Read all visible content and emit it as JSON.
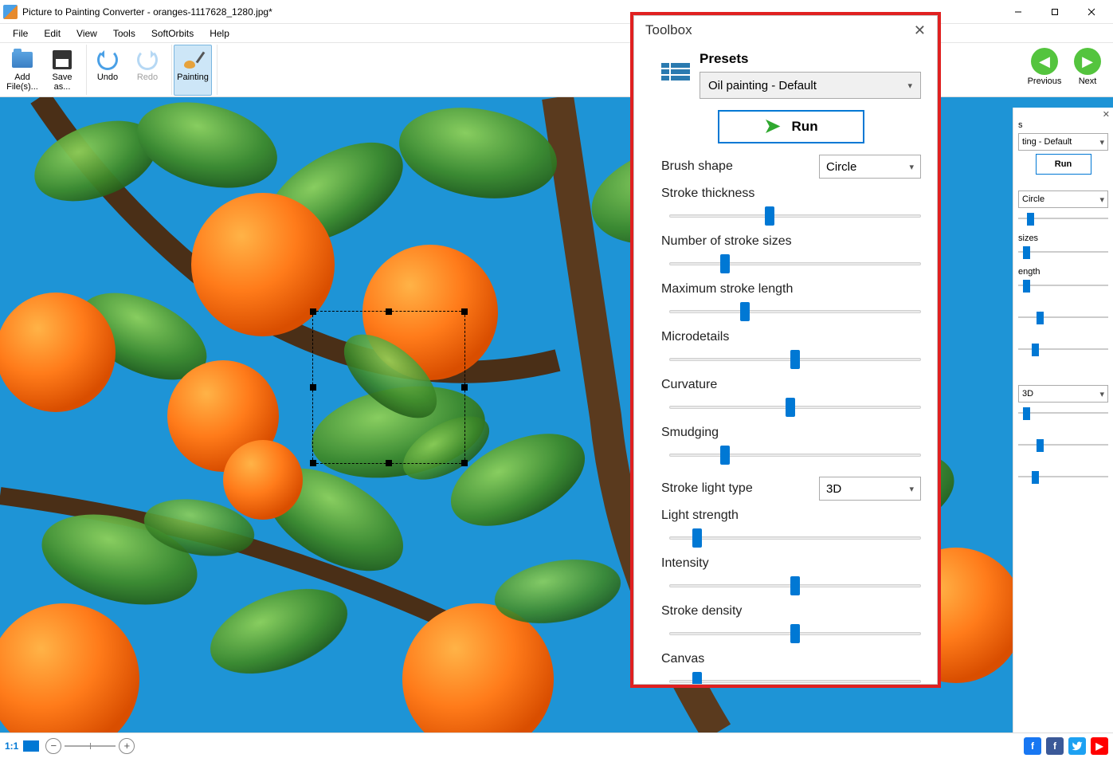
{
  "window": {
    "title": "Picture to Painting Converter - oranges-1117628_1280.jpg*"
  },
  "menu": {
    "file": "File",
    "edit": "Edit",
    "view": "View",
    "tools": "Tools",
    "softorbits": "SoftOrbits",
    "help": "Help"
  },
  "toolbar": {
    "add_files": "Add File(s)...",
    "save_as": "Save as...",
    "undo": "Undo",
    "redo": "Redo",
    "painting": "Painting",
    "previous": "Previous",
    "next": "Next"
  },
  "status": {
    "zoom": "1:1"
  },
  "sidepanel": {
    "preset": "ting - Default",
    "run": "Run",
    "brush_value": "Circle",
    "sizes_label": "sizes",
    "length_label": "ength",
    "light_value": "3D"
  },
  "toolbox": {
    "title": "Toolbox",
    "presets_label": "Presets",
    "preset_value": "Oil painting - Default",
    "run": "Run",
    "brush_shape_label": "Brush shape",
    "brush_shape_value": "Circle",
    "stroke_thickness_label": "Stroke thickness",
    "stroke_thickness_value": 40,
    "num_sizes_label": "Number of stroke sizes",
    "num_sizes_value": 22,
    "max_length_label": "Maximum stroke length",
    "max_length_value": 30,
    "microdetails_label": "Microdetails",
    "microdetails_value": 50,
    "curvature_label": "Curvature",
    "curvature_value": 48,
    "smudging_label": "Smudging",
    "smudging_value": 22,
    "stroke_light_type_label": "Stroke light type",
    "stroke_light_type_value": "3D",
    "light_strength_label": "Light strength",
    "light_strength_value": 11,
    "intensity_label": "Intensity",
    "intensity_value": 50,
    "stroke_density_label": "Stroke density",
    "stroke_density_value": 50,
    "canvas_label": "Canvas",
    "canvas_value": 11
  }
}
